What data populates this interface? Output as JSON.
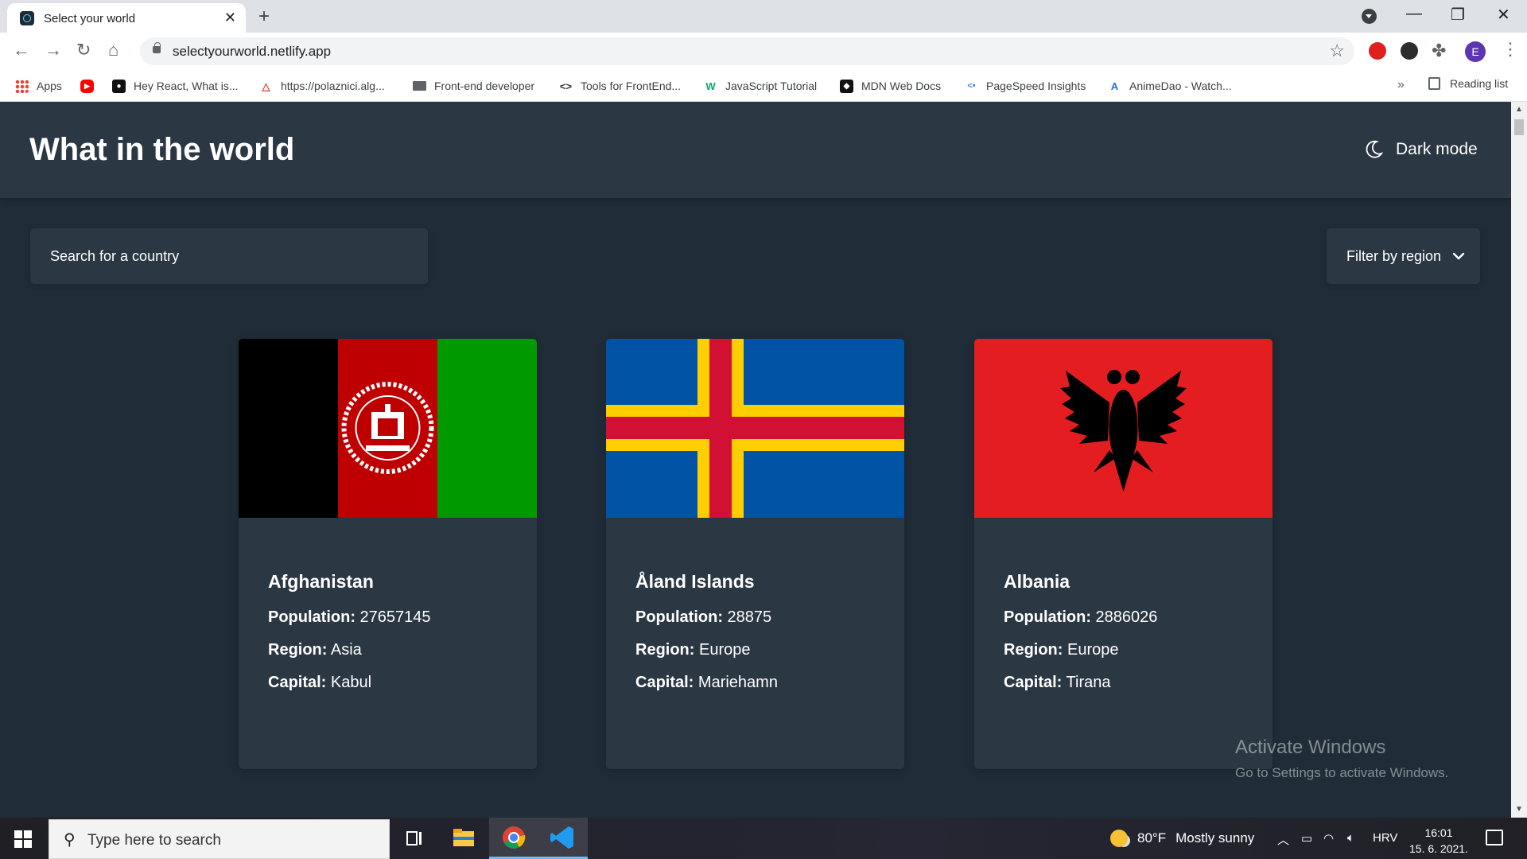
{
  "browser": {
    "tab_title": "Select your world",
    "tab_close": "✕",
    "new_tab": "+",
    "url": "selectyourworld.netlify.app",
    "window_controls": {
      "minimize": "—",
      "maximize": "❐",
      "close": "✕"
    },
    "profile_initial": "E",
    "bookmarks": [
      {
        "label": "Apps",
        "icon": "apps-grid-icon"
      },
      {
        "label": "",
        "icon": "youtube-icon"
      },
      {
        "label": "Hey React, What is...",
        "icon": "bookmark-favicon-icon"
      },
      {
        "label": "https://polaznici.alg...",
        "icon": "bookmark-favicon-icon"
      },
      {
        "label": "Front-end developer",
        "icon": "bookmark-favicon-icon"
      },
      {
        "label": "Tools for FrontEnd...",
        "icon": "code-brackets-icon"
      },
      {
        "label": "JavaScript Tutorial",
        "icon": "w3schools-icon"
      },
      {
        "label": "MDN Web Docs",
        "icon": "mdn-icon"
      },
      {
        "label": "PageSpeed Insights",
        "icon": "pagespeed-icon"
      },
      {
        "label": "AnimeDao - Watch...",
        "icon": "animedao-icon"
      }
    ],
    "bookmarks_more": "»",
    "reading_list": "Reading list"
  },
  "page": {
    "site_title": "What in the world",
    "dark_mode_label": "Dark mode",
    "search_placeholder": "Search for a country",
    "filter_label": "Filter by region",
    "colors": {
      "background": "#202c37",
      "element": "#2b3743",
      "text": "#ffffff"
    },
    "countries": [
      {
        "name": "Afghanistan",
        "population_label": "Population:",
        "population": "27657145",
        "region_label": "Region:",
        "region": "Asia",
        "capital_label": "Capital:",
        "capital": "Kabul",
        "flag_colors": [
          "#000000",
          "#be0000",
          "#009900"
        ]
      },
      {
        "name": "Åland Islands",
        "population_label": "Population:",
        "population": "28875",
        "region_label": "Region:",
        "region": "Europe",
        "capital_label": "Capital:",
        "capital": "Mariehamn",
        "flag_colors": [
          "#0053a5",
          "#ffce00",
          "#d21034"
        ]
      },
      {
        "name": "Albania",
        "population_label": "Population:",
        "population": "2886026",
        "region_label": "Region:",
        "region": "Europe",
        "capital_label": "Capital:",
        "capital": "Tirana",
        "flag_colors": [
          "#e41e20",
          "#000000"
        ]
      }
    ],
    "activation": {
      "line1": "Activate Windows",
      "line2": "Go to Settings to activate Windows."
    }
  },
  "taskbar": {
    "search_placeholder": "Type here to search",
    "weather_temp": "80°F",
    "weather_text": "Mostly sunny",
    "language": "HRV",
    "time": "16:01",
    "date": "15. 6. 2021."
  }
}
